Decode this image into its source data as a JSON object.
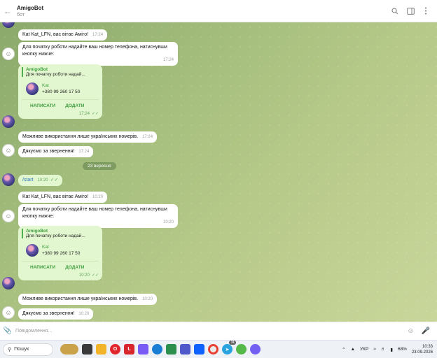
{
  "header": {
    "title": "AmigoBot",
    "subtitle": "бот"
  },
  "messages": {
    "greet1": {
      "text": "Kat Kat_LFN, вас вітає Аміго!",
      "time": "17:24"
    },
    "prompt1": {
      "text": "Для початку роботи надайте ваш номер телефона, натиснувши кнопку нижче:",
      "time": "17:24"
    },
    "card1": {
      "reply_name": "AmigoBot",
      "reply_text": "Для початку роботи надай...",
      "contact_name": "Kat",
      "contact_phone": "+380 99 260 17 50",
      "action_write": "НАПИСАТИ",
      "action_add": "ДОДАТИ",
      "time": "17:24"
    },
    "only_ua1": {
      "text": "Можливе використання лише українських номерів.",
      "time": "17:24"
    },
    "thanks1": {
      "text": "Дякуємо за звернення!",
      "time": "17:24"
    },
    "date_divider": "23 вересня",
    "start": {
      "text": "/start",
      "time": "10:20"
    },
    "greet2": {
      "text": "Kat Kat_LFN, вас вітає Аміго!",
      "time": "10:20"
    },
    "prompt2": {
      "text": "Для початку роботи надайте ваш номер телефона, натиснувши кнопку нижче:",
      "time": "10:20"
    },
    "card2": {
      "reply_name": "AmigoBot",
      "reply_text": "Для початку роботи надай...",
      "contact_name": "Kat",
      "contact_phone": "+380 99 260 17 50",
      "action_write": "НАПИСАТИ",
      "action_add": "ДОДАТИ",
      "time": "10:20"
    },
    "only_ua2": {
      "text": "Можливе використання лише українських номерів.",
      "time": "10:20"
    },
    "thanks2": {
      "text": "Дякуємо за звернення!",
      "time": "10:20"
    }
  },
  "composer": {
    "placeholder": "Повідомлення..."
  },
  "taskbar": {
    "search_label": "Пошук",
    "lang": "УКР",
    "battery": "68%",
    "time": "10:33",
    "date": "23.09.2026",
    "telegram_badge": "31"
  },
  "colors": {
    "outgoing_bubble": "#e2f7cf",
    "accent_green": "#3e9d3e",
    "link_blue": "#2b7bc0"
  }
}
